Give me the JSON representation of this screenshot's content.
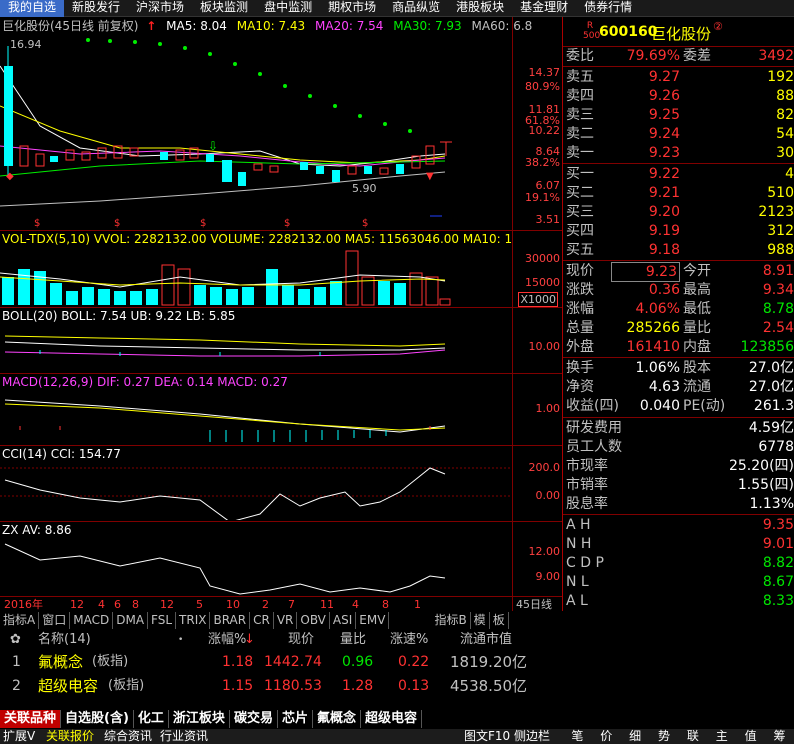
{
  "topnav": {
    "tabs": [
      "我的自选",
      "新股发行",
      "沪深市场",
      "板块监测",
      "盘中监测",
      "期权市场",
      "商品纵览",
      "港股板块",
      "基金理财",
      "债券行情"
    ]
  },
  "chart_header": {
    "title": "巨化股份(45日线 前复权)",
    "ma5": "MA5: 8.04",
    "ma10": "MA10: 7.43",
    "ma20": "MA20: 7.54",
    "ma30": "MA30: 7.93",
    "ma60": "MA60: 6.8"
  },
  "kline_labels": {
    "p1": "14.37",
    "p2": "80.9%",
    "p3": "11.81",
    "p4": "61.8%",
    "p5": "10.22",
    "p6": "8.64",
    "p7": "38.2%",
    "p8": "6.07",
    "p9": "19.1%",
    "p10": "3.51",
    "high_mark": "16.94",
    "low_mark": "5.90"
  },
  "vol": {
    "header": "VOL-TDX(5,10)  VVOL: 2282132.00  VOLUME: 2282132.00  MA5: 11563046.00  MA10: 1303",
    "l1": "30000",
    "l2": "15000",
    "unit": "X1000"
  },
  "boll": {
    "header": "BOLL(20)  BOLL: 7.54  UB: 9.22  LB: 5.85",
    "l1": "10.00"
  },
  "macd": {
    "header": "MACD(12,26,9)  DIF: 0.27  DEA: 0.14  MACD: 0.27",
    "l1": "1.00"
  },
  "cci": {
    "header": "CCI(14)  CCI: 154.77",
    "l1": "200.0",
    "l2": "0.00"
  },
  "zx": {
    "header": "ZX  AV: 8.86",
    "l1": "12.00",
    "l2": "9.00"
  },
  "xaxis": {
    "labels": [
      "2016年",
      "12",
      "4",
      "6",
      "8",
      "12",
      "5",
      "10",
      "2",
      "7",
      "11",
      "4",
      "8",
      "1"
    ],
    "right": "45日线"
  },
  "ind_tabs": [
    "指标A",
    "窗口",
    "MACD",
    "DMA",
    "FSL",
    "TRIX",
    "BRAR",
    "CR",
    "VR",
    "OBV",
    "ASI",
    "EMV",
    "指标B",
    "模",
    "板"
  ],
  "stock": {
    "code": "600160",
    "name": "巨化股份",
    "badge": "R 500"
  },
  "quote": {
    "weibi_k": "委比",
    "weibi_v": "79.69%",
    "weicha_k": "委差",
    "weicha_v": "3492",
    "asks": [
      {
        "k": "卖五",
        "p": "9.27",
        "q": "192"
      },
      {
        "k": "卖四",
        "p": "9.26",
        "q": "88"
      },
      {
        "k": "卖三",
        "p": "9.25",
        "q": "82"
      },
      {
        "k": "卖二",
        "p": "9.24",
        "q": "54"
      },
      {
        "k": "卖一",
        "p": "9.23",
        "q": "30"
      }
    ],
    "bids": [
      {
        "k": "买一",
        "p": "9.22",
        "q": "4"
      },
      {
        "k": "买二",
        "p": "9.21",
        "q": "510"
      },
      {
        "k": "买三",
        "p": "9.20",
        "q": "2123"
      },
      {
        "k": "买四",
        "p": "9.19",
        "q": "312"
      },
      {
        "k": "买五",
        "p": "9.18",
        "q": "988"
      }
    ],
    "stats": [
      {
        "k1": "现价",
        "v1": "9.23",
        "k2": "今开",
        "v2": "8.91"
      },
      {
        "k1": "涨跌",
        "v1": "0.36",
        "k2": "最高",
        "v2": "9.34"
      },
      {
        "k1": "涨幅",
        "v1": "4.06%",
        "k2": "最低",
        "v2": "8.78"
      },
      {
        "k1": "总量",
        "v1": "285266",
        "k2": "量比",
        "v2": "2.54"
      },
      {
        "k1": "外盘",
        "v1": "161410",
        "k2": "内盘",
        "v2": "123856"
      }
    ],
    "stats2": [
      {
        "k1": "换手",
        "v1": "1.06%",
        "k2": "股本",
        "v2": "27.0亿"
      },
      {
        "k1": "净资",
        "v1": "4.63",
        "k2": "流通",
        "v2": "27.0亿"
      },
      {
        "k1": "收益(四)",
        "v1": "0.040",
        "k2": "PE(动)",
        "v2": "261.3"
      }
    ],
    "fin": [
      {
        "k": "研发费用",
        "v": "4.59亿"
      },
      {
        "k": "员工人数",
        "v": "6778"
      },
      {
        "k": "市现率",
        "v": "25.20(四)"
      },
      {
        "k": "市销率",
        "v": "1.55(四)"
      },
      {
        "k": "股息率",
        "v": "1.13%"
      }
    ],
    "rel": [
      {
        "k": "A H",
        "v": "9.35"
      },
      {
        "k": "N H",
        "v": "9.01"
      },
      {
        "k": "C D P",
        "v": "8.82"
      },
      {
        "k": "N L",
        "v": "8.67"
      },
      {
        "k": "A L",
        "v": "8.33"
      }
    ]
  },
  "list": {
    "header": {
      "name": "名称(14)",
      "chg": "涨幅%",
      "price": "现价",
      "vr": "量比",
      "speed": "涨速%",
      "mcap": "流通市值"
    },
    "rows": [
      {
        "idx": "1",
        "name": "氟概念",
        "type": "(板指)",
        "chg": "1.18",
        "price": "1442.74",
        "vr": "0.96",
        "speed": "0.22",
        "mcap": "1819.20亿"
      },
      {
        "idx": "2",
        "name": "超级电容",
        "type": "(板指)",
        "chg": "1.15",
        "price": "1180.53",
        "vr": "1.28",
        "speed": "0.13",
        "mcap": "4538.50亿"
      }
    ]
  },
  "bottabs": [
    "关联品种",
    "自选股(含)",
    "化工",
    "浙江板块",
    "碳交易",
    "芯片",
    "氟概念",
    "超级电容"
  ],
  "statusbar": {
    "left": [
      "扩展V",
      "关联报价",
      "综合资讯",
      "行业资讯"
    ],
    "mid": "图文F10 侧边栏",
    "right": [
      "笔",
      "价",
      "细",
      "势",
      "联",
      "主",
      "值",
      "筹"
    ]
  }
}
